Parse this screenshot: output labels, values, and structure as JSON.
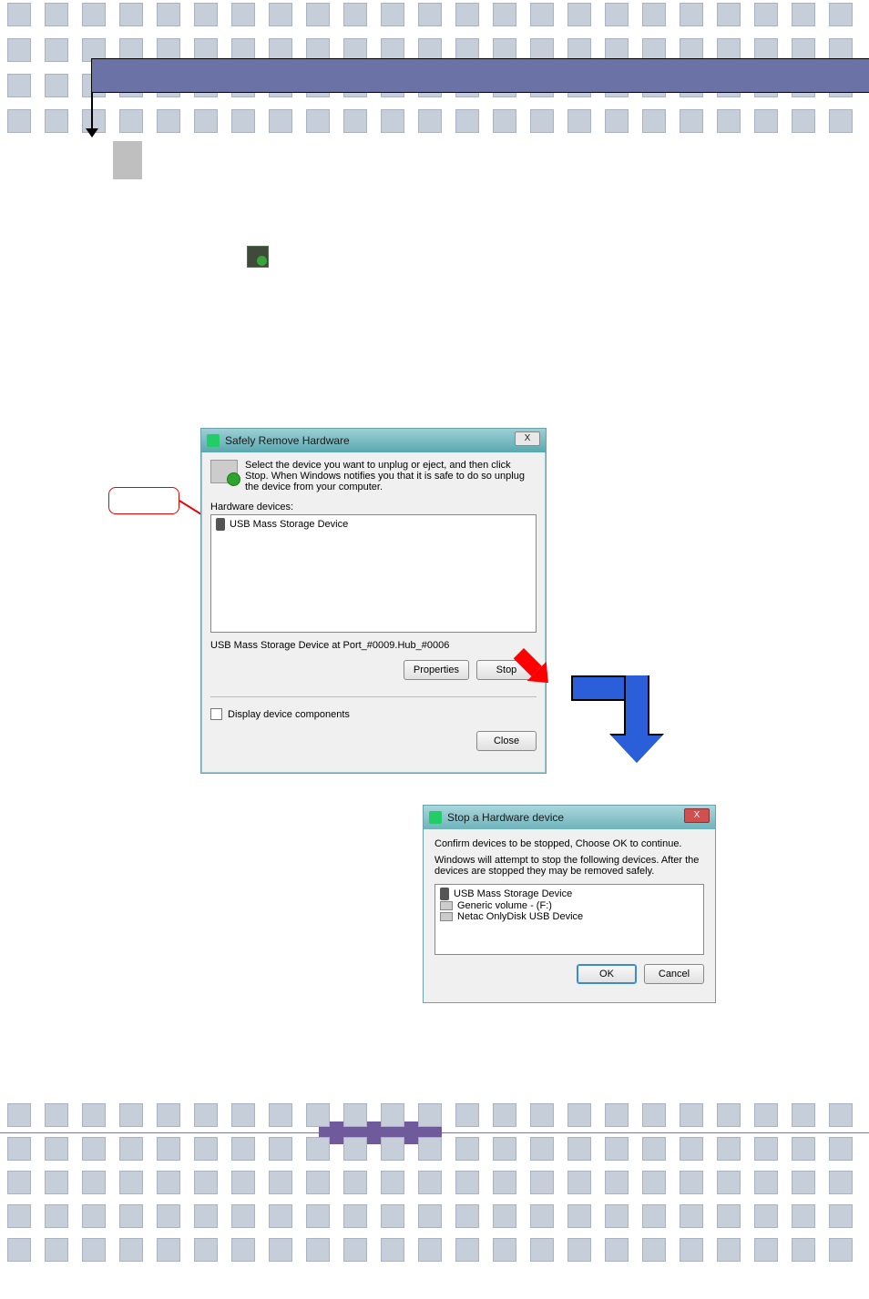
{
  "dialog1": {
    "title": "Safely Remove Hardware",
    "intro": "Select the device you want to unplug or eject, and then click Stop. When Windows notifies you that it is safe to do so unplug the device from your computer.",
    "hw_label": "Hardware devices:",
    "item": "USB Mass Storage Device",
    "status": "USB Mass Storage Device at Port_#0009.Hub_#0006",
    "btn_properties": "Properties",
    "btn_stop": "Stop",
    "chk_label": "Display device components",
    "btn_close": "Close"
  },
  "dialog2": {
    "title": "Stop a Hardware device",
    "confirm": "Confirm devices to be stopped, Choose OK to continue.",
    "warn": "Windows will attempt to stop the following devices. After the devices are stopped they may be removed safely.",
    "items": [
      "USB Mass Storage Device",
      "Generic volume - (F:)",
      "Netac OnlyDisk USB Device"
    ],
    "btn_ok": "OK",
    "btn_cancel": "Cancel"
  },
  "close_x": "X"
}
